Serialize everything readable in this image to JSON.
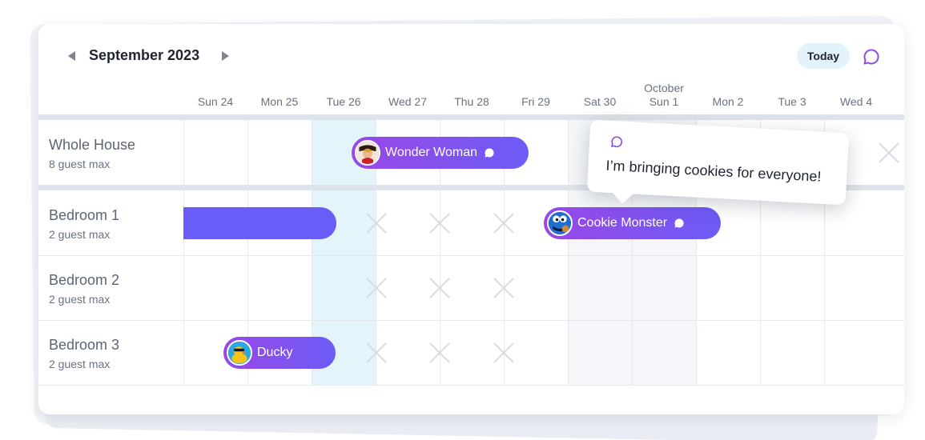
{
  "header": {
    "month_title": "September 2023",
    "today_label": "Today"
  },
  "days": [
    "Sun 24",
    "Mon 25",
    "Tue 26",
    "Wed 27",
    "Thu 28",
    "Fri 29",
    "Sat 30",
    "Sun 1",
    "Mon 2",
    "Tue 3",
    "Wed 4"
  ],
  "month_marker": "October",
  "rooms": [
    {
      "name": "Whole House",
      "capacity": "8 guest max"
    },
    {
      "name": "Bedroom 1",
      "capacity": "2 guest max"
    },
    {
      "name": "Bedroom 2",
      "capacity": "2 guest max"
    },
    {
      "name": "Bedroom 3",
      "capacity": "2 guest max"
    }
  ],
  "bookings": {
    "wonder_woman": "Wonder Woman",
    "cookie_monster": "Cookie Monster",
    "ducky": "Ducky"
  },
  "tooltip": {
    "text": "I’m bringing cookies for everyone!"
  },
  "colors": {
    "accent": "#6a5cf6",
    "accent_purple": "#9a47e6",
    "today_highlight": "#e3f4fb"
  },
  "icons": {
    "prev": "triangle-left",
    "next": "triangle-right",
    "chat": "speech-bubble",
    "unavailable": "x-mark"
  }
}
